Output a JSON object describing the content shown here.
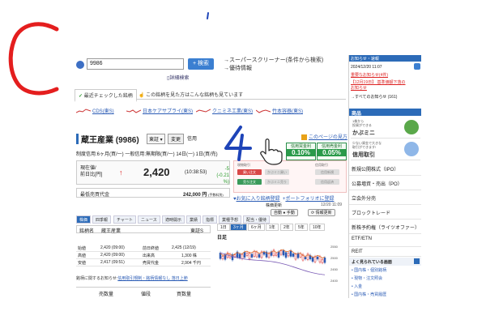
{
  "search": {
    "value": "9986",
    "button": "検索",
    "detail": "詳細検索"
  },
  "links": {
    "screener": "→スーパースクリーナー(条件から検索)",
    "special": "→優待情報"
  },
  "tabs": {
    "recent": "最近チェックした銘柄",
    "suggest": "この銘柄を見た方はこんな銘柄も見ています"
  },
  "favorites": [
    "CDS(東S)",
    "日本ケアサプライ(東S)",
    "クニミネ工業(東S)",
    "竹本容器(東S)"
  ],
  "stock": {
    "name": "蔵王産業 (9986)",
    "exchange": "東証",
    "change_btn": "変更",
    "credit": "信用",
    "system": "制度信用:6ヶ月(買/一)  一般信用:無期限(買/一)  14日(一)  1日(買/売)",
    "next_page": "このページの見方",
    "rate1_label": "信用買金利",
    "rate1_value": "0.10%",
    "rate2_label": "信用売金利",
    "rate2_value": "0.05%",
    "price_label_1": "現在値/",
    "price_label_2": "前日比[円]",
    "price": "2,420",
    "price_time": "(10:38:53)",
    "diff": "-5",
    "diff_pct": "(-0.21 %)",
    "min_vol_label": "最低売買代金",
    "min_vol_value": "242,000 円",
    "min_vol_note": "(手数料別)",
    "order_h1": "現物取引",
    "order_h2": "信用取引",
    "order_btns": [
      "買い注文",
      "売り注文",
      "かぶミニ買い",
      "かぶミニ売り",
      "信用新規",
      "信用返済"
    ],
    "add_fav": "お気に入り銘柄登録",
    "add_portfolio": "ポートフォリオに登録"
  },
  "subtabs": [
    "株価",
    "四季報",
    "チャート",
    "ニュース",
    "適時開示",
    "業績",
    "指標",
    "業種予想",
    "配当・優待"
  ],
  "lower": {
    "name_label": "銘柄名",
    "name_value": "蔵王産業",
    "market": "東証S",
    "rows": [
      [
        "始値",
        "2,420 (09:00)",
        "前日終値",
        "2,425 (12/19)"
      ],
      [
        "高値",
        "2,420 (09:00)",
        "出来高",
        "1,300 株"
      ],
      [
        "安値",
        "2,417 (09:51)",
        "売買代金",
        "2,904 千円"
      ]
    ],
    "note_a": "銘柄に関するお知らせ:",
    "note_b": "信用取引規制・銘柄情報なし 落日上節",
    "book_sell": "売数量",
    "book_price": "値段",
    "book_buy": "買数量"
  },
  "chart_ctl": {
    "updated": "株価更新",
    "time": "12/20 11:09",
    "auto": "自動",
    "manual": "手動",
    "refresh": "情報更新"
  },
  "chart": {
    "periods": [
      "1日",
      "3ヶ月",
      "6ヶ月",
      "1年",
      "2年",
      "5年",
      "10年"
    ],
    "active_period": "3ヶ月",
    "kind": "日足",
    "y_ticks": [
      "2550",
      "2500",
      "2450",
      "2400"
    ]
  },
  "side": {
    "news_header": "お知らせ・速報",
    "news_time": "2024/12/20 11:07",
    "news_red1": "重要なお知らせ(4件)",
    "news_red2": "【12月19日】 基準価額下落の",
    "news_red3": "お知らせ",
    "news_all": "→すべてのお知らせ (161)",
    "product_header": "商品",
    "promo1_small": "1株から\n投資ができる",
    "promo1_big": "かぶミニ",
    "promo2_small": "少ない資金で大きな\n取引ができます!",
    "promo2_big": "信用取引",
    "menus": [
      "新規公開株式（IPO）",
      "公募増資・売出（PO）",
      "立会外分売",
      "ブロックトレード",
      "新株予約権（ライツオファー）",
      "ETF/ETN",
      "REIT"
    ],
    "often": "よく見られている画面",
    "often_links": [
      "国内株・個別銘柄",
      "現物・注文照会",
      "入金",
      "国内株・売買履歴"
    ]
  },
  "annotation": {
    "number": "4"
  }
}
